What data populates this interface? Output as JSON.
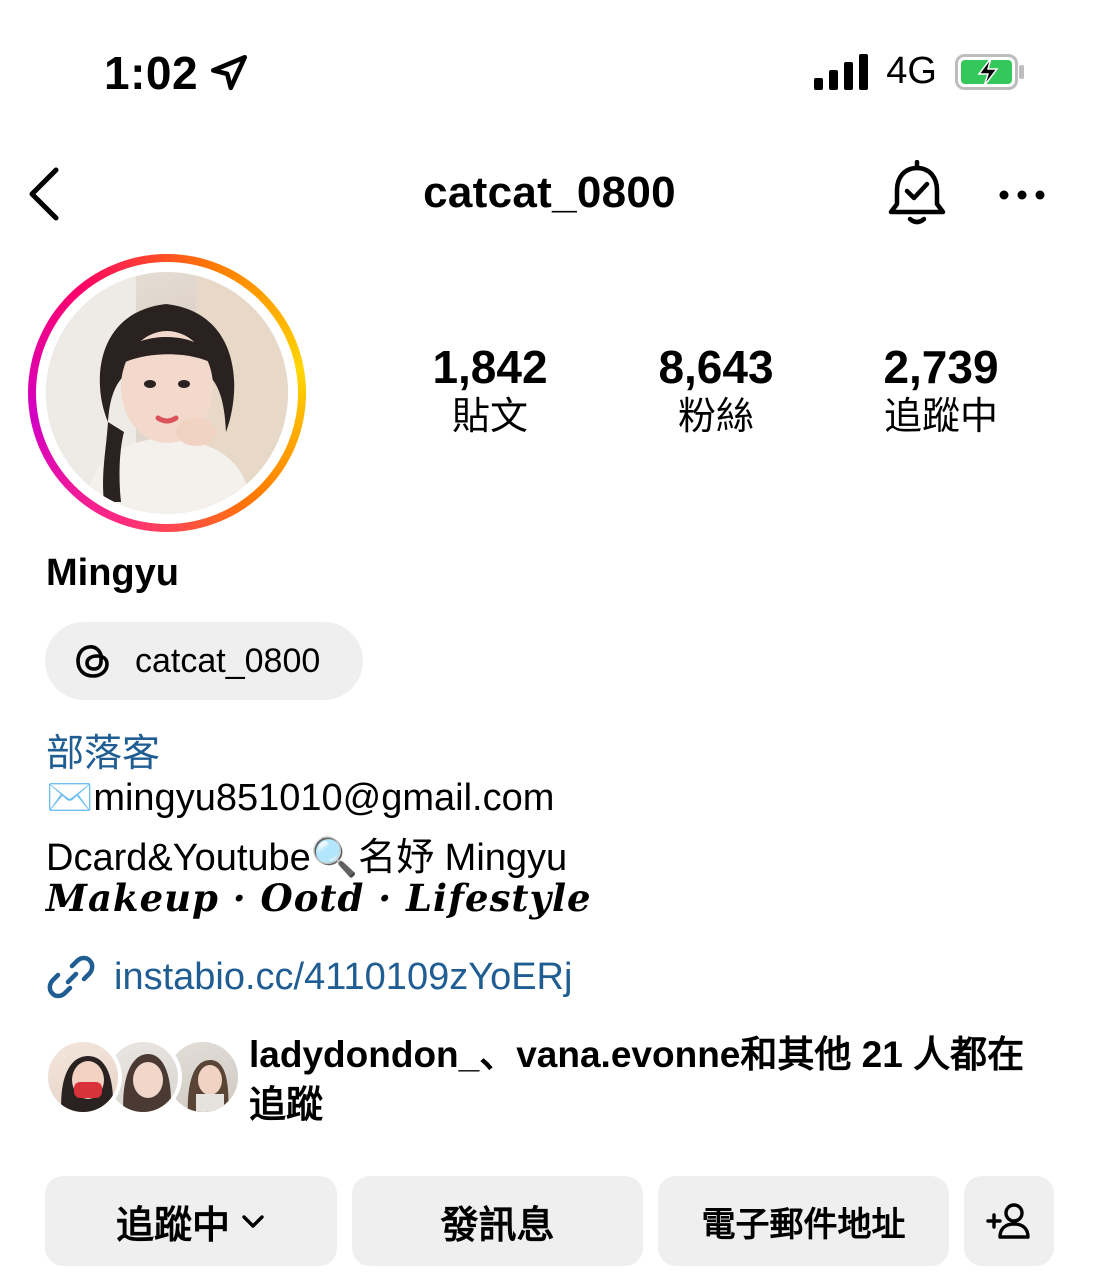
{
  "status_bar": {
    "time": "1:02",
    "network": "4G",
    "location_icon": "location-arrow-icon",
    "signal_icon": "cellular-signal-icon",
    "battery_icon": "battery-charging-icon",
    "battery_color": "#34c759"
  },
  "header": {
    "username": "catcat_0800",
    "back_icon": "chevron-left-icon",
    "bell_icon": "bell-check-icon",
    "more_icon": "more-horizontal-icon"
  },
  "stats": [
    {
      "value": "1,842",
      "label": "貼文"
    },
    {
      "value": "8,643",
      "label": "粉絲"
    },
    {
      "value": "2,739",
      "label": "追蹤中"
    }
  ],
  "profile": {
    "display_name": "Mingyu",
    "threads_handle": "catcat_0800",
    "category": "部落客",
    "bio": {
      "email_emoji": "✉️",
      "email": "mingyu851010@gmail.com",
      "line2_prefix": "Dcard&Youtube",
      "line2_emoji": "🔍",
      "line2_suffix": "名妤 Mingyu",
      "line3": "Makeup · Ootd · Lifestyle"
    },
    "link": "instabio.cc/4110109zYoERj",
    "followed_by": {
      "names": "ladydondon_、vana.evonne",
      "rest": "和其他 21 人都在追蹤"
    }
  },
  "buttons": {
    "following": "追蹤中",
    "message": "發訊息",
    "email": "電子郵件地址"
  },
  "colors": {
    "link_blue": "#1f5d92",
    "button_bg": "#efefef"
  }
}
